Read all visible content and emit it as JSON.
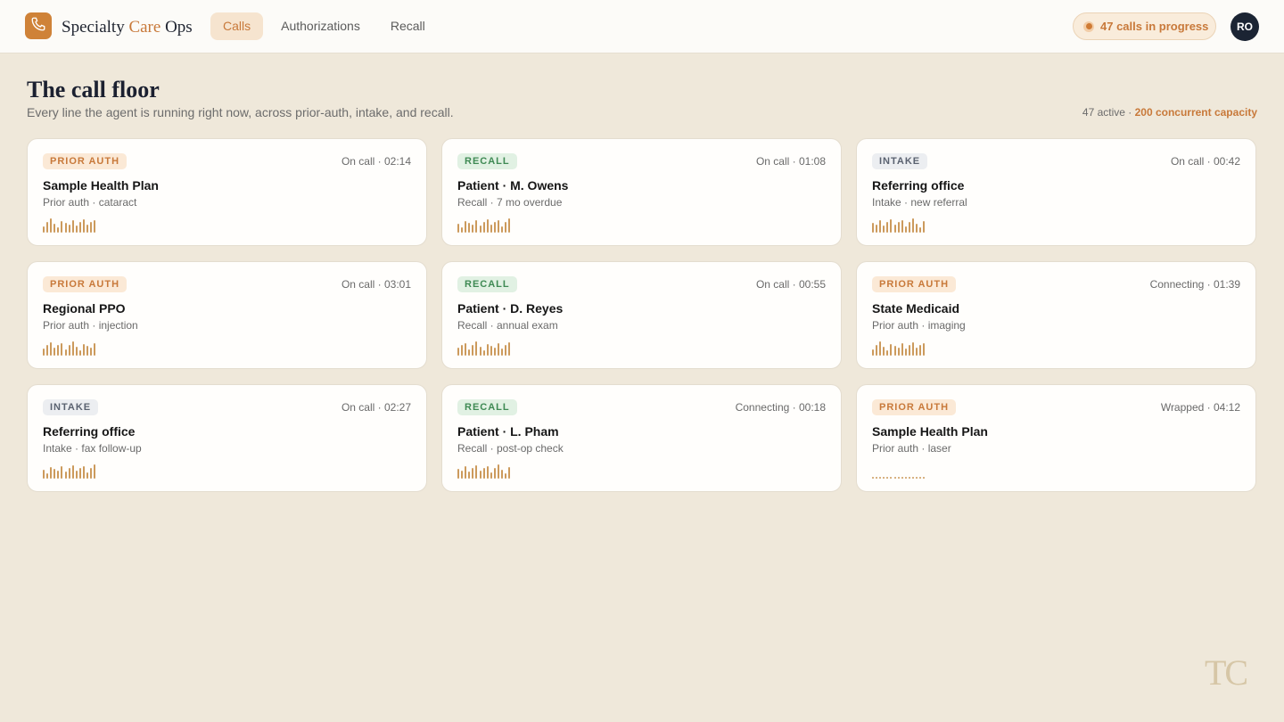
{
  "app": {
    "brand_primary": "Specialty",
    "brand_accent": "Care",
    "brand_secondary": "Ops",
    "logo_icon": "phone-icon",
    "accent_color": "#c8793a"
  },
  "nav": {
    "tabs": [
      {
        "label": "Calls",
        "active": true
      },
      {
        "label": "Authorizations",
        "active": false
      },
      {
        "label": "Recall",
        "active": false
      }
    ]
  },
  "status_pill": {
    "label": "47 calls in progress",
    "icon": "live-dot-icon"
  },
  "user": {
    "initials": "RO"
  },
  "header": {
    "title": "The call floor",
    "subtitle": "Every line the agent is running right now, across prior-auth, intake, and recall.",
    "active_count": "47 active",
    "separator": " · ",
    "capacity": "200 concurrent capacity"
  },
  "calls": [
    {
      "badge": "PRIOR AUTH",
      "kind": "prior-auth",
      "status": "On call · 02:14",
      "title": "Sample Health Plan",
      "subtitle": "Prior auth · cataract",
      "waveform": "active"
    },
    {
      "badge": "RECALL",
      "kind": "recall",
      "status": "On call · 01:08",
      "title": "Patient · M. Owens",
      "subtitle": "Recall · 7 mo overdue",
      "waveform": "active"
    },
    {
      "badge": "INTAKE",
      "kind": "intake",
      "status": "On call · 00:42",
      "title": "Referring office",
      "subtitle": "Intake · new referral",
      "waveform": "active"
    },
    {
      "badge": "PRIOR AUTH",
      "kind": "prior-auth",
      "status": "On call · 03:01",
      "title": "Regional PPO",
      "subtitle": "Prior auth · injection",
      "waveform": "active"
    },
    {
      "badge": "RECALL",
      "kind": "recall",
      "status": "On call · 00:55",
      "title": "Patient · D. Reyes",
      "subtitle": "Recall · annual exam",
      "waveform": "active"
    },
    {
      "badge": "PRIOR AUTH",
      "kind": "prior-auth",
      "status": "Connecting · 01:39",
      "title": "State Medicaid",
      "subtitle": "Prior auth · imaging",
      "waveform": "active"
    },
    {
      "badge": "INTAKE",
      "kind": "intake",
      "status": "On call · 02:27",
      "title": "Referring office",
      "subtitle": "Intake · fax follow-up",
      "waveform": "active"
    },
    {
      "badge": "RECALL",
      "kind": "recall",
      "status": "Connecting · 00:18",
      "title": "Patient · L. Pham",
      "subtitle": "Recall · post-op check",
      "waveform": "active"
    },
    {
      "badge": "PRIOR AUTH",
      "kind": "prior-auth",
      "status": "Wrapped · 04:12",
      "title": "Sample Health Plan",
      "subtitle": "Prior auth · laser",
      "waveform": "flat"
    }
  ],
  "watermark": "TC"
}
